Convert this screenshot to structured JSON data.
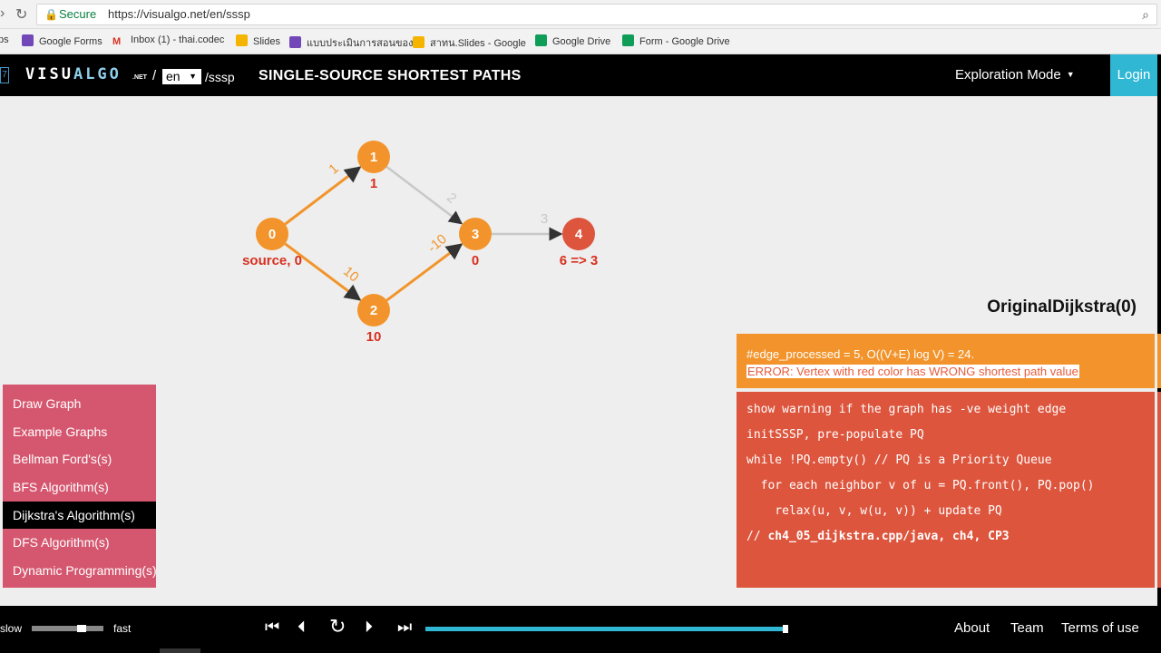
{
  "browser": {
    "secure_label": "Secure",
    "url": "https://visualgo.net/en/sssp",
    "bookmarks": [
      {
        "label": "ps",
        "color": "#5a7ed6"
      },
      {
        "label": "Google Forms",
        "color": "#7248b9"
      },
      {
        "label": "Inbox (1) - thai.codec",
        "color": "#d93025"
      },
      {
        "label": "Slides",
        "color": "#f4b400"
      },
      {
        "label": "แบบประเมินการสอนของ",
        "color": "#7248b9"
      },
      {
        "label": "สาทน.Slides - Google",
        "color": "#f4b400"
      },
      {
        "label": "Google Drive",
        "color": "#0f9d58"
      },
      {
        "label": "Form - Google Drive",
        "color": "#0f9d58"
      }
    ]
  },
  "nav": {
    "logo_prefix": "VISU",
    "logo_highlight": "ALGO",
    "logo_suffix": ".NET",
    "slash": "/",
    "lang": "en",
    "path": "/sssp",
    "title": "SINGLE-SOURCE SHORTEST PATHS",
    "mode": "Exploration Mode",
    "login": "Login"
  },
  "graph": {
    "vertices": [
      {
        "id": "0",
        "label": "source, 0",
        "color": "#f2942b",
        "label_color": "#d7301f"
      },
      {
        "id": "1",
        "label": "1",
        "color": "#f2942b",
        "label_color": "#d7301f"
      },
      {
        "id": "2",
        "label": "10",
        "color": "#f2942b",
        "label_color": "#d7301f"
      },
      {
        "id": "3",
        "label": "0",
        "color": "#f2942b",
        "label_color": "#d7301f"
      },
      {
        "id": "4",
        "label": "6 => 3",
        "color": "#dd553d",
        "label_color": "#d7301f"
      }
    ],
    "edges": [
      {
        "from": "0",
        "to": "1",
        "weight": "1",
        "color": "#f2942b"
      },
      {
        "from": "0",
        "to": "2",
        "weight": "10",
        "color": "#f2942b"
      },
      {
        "from": "1",
        "to": "3",
        "weight": "2",
        "color": "#c8c8c8"
      },
      {
        "from": "2",
        "to": "3",
        "weight": "-10",
        "color": "#f2942b"
      },
      {
        "from": "3",
        "to": "4",
        "weight": "3",
        "color": "#c8c8c8"
      }
    ]
  },
  "algo": {
    "title": "OriginalDijkstra(0)",
    "status_line1": "#edge_processed = 5, O((V+E) log V) = 24.",
    "status_line2": "ERROR: Vertex with red color has WRONG shortest path value",
    "code": [
      "show warning if the graph has -ve weight edge",
      "initSSSP, pre-populate PQ",
      "while !PQ.empty() // PQ is a Priority Queue",
      "  for each neighbor v of u = PQ.front(), PQ.pop()",
      "    relax(u, v, w(u, v)) + update PQ"
    ],
    "code_comment_prefix": "// ",
    "code_comment_bold": "ch4_05_dijkstra.cpp/java, ch4, CP3"
  },
  "menu": {
    "items": [
      "Draw Graph",
      "Example Graphs",
      "Bellman Ford's(s)",
      "BFS Algorithm(s)",
      "Dijkstra's Algorithm(s)",
      "DFS Algorithm(s)",
      "Dynamic Programming(s)"
    ],
    "active_index": 4
  },
  "bottom": {
    "slow": "slow",
    "fast": "fast",
    "speed_fraction": 0.72,
    "progress_fraction": 1.0,
    "links": [
      "About",
      "Team",
      "Terms of use"
    ]
  }
}
